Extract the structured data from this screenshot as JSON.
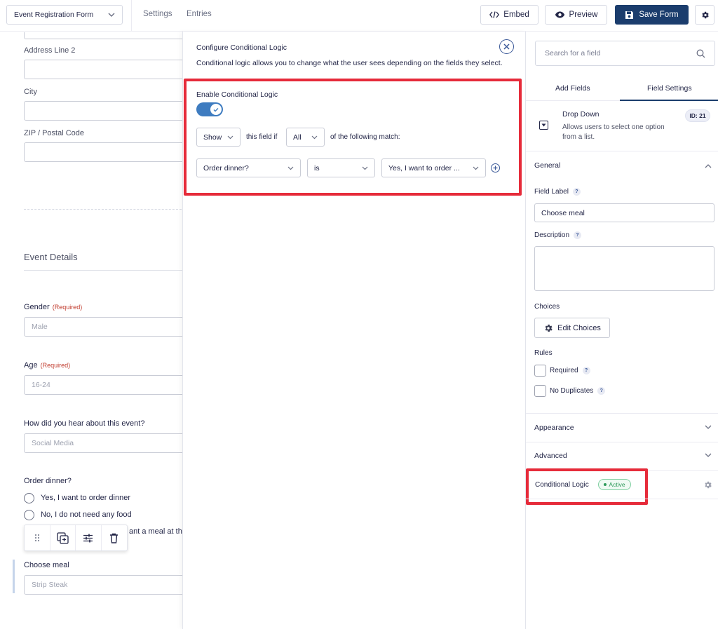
{
  "header": {
    "form_select": "Event Registration Form",
    "tabs": [
      "Settings",
      "Entries"
    ],
    "embed_label": "Embed",
    "preview_label": "Preview",
    "save_label": "Save Form"
  },
  "canvas": {
    "fields": [
      {
        "label": "Address Line 2"
      },
      {
        "label": "City"
      },
      {
        "label": "ZIP / Postal Code"
      }
    ],
    "section_title": "Event Details",
    "gender": {
      "label": "Gender",
      "required": "(Required)",
      "placeholder": "Male"
    },
    "age": {
      "label": "Age",
      "required": "(Required)",
      "placeholder": "16-24"
    },
    "hear": {
      "label": "How did you hear about this event?",
      "placeholder": "Social Media"
    },
    "dinner": {
      "label": "Order dinner?",
      "options": [
        "Yes, I want to order dinner",
        "No, I do not need any food"
      ],
      "partial_option": "ant a meal at th"
    },
    "choose_meal": {
      "label": "Choose meal",
      "placeholder": "Strip Steak"
    }
  },
  "modal": {
    "title": "Configure Conditional Logic",
    "description": "Conditional logic allows you to change what the user sees depending on the fields they select.",
    "enable_label": "Enable Conditional Logic",
    "toggle_on": true,
    "action": "Show",
    "this_field_if": "this field if",
    "match": "All",
    "following": "of the following match:",
    "rule": {
      "field": "Order dinner?",
      "operator": "is",
      "value": "Yes, I want to order ..."
    }
  },
  "sidebar": {
    "search_placeholder": "Search for a field",
    "tabs": [
      "Add Fields",
      "Field Settings"
    ],
    "active_tab": "Field Settings",
    "field_type": "Drop Down",
    "field_type_desc_1": "Allows users to select one option",
    "field_type_desc_2": "from a list.",
    "field_id": "ID: 21",
    "general": "General",
    "field_label_title": "Field Label",
    "field_label_value": "Choose meal",
    "description_title": "Description",
    "choices_title": "Choices",
    "edit_choices": "Edit Choices",
    "rules_title": "Rules",
    "rule_required": "Required",
    "rule_no_duplicates": "No Duplicates",
    "appearance": "Appearance",
    "advanced": "Advanced",
    "conditional_logic": "Conditional Logic",
    "active_badge": "Active"
  },
  "colors": {
    "primary": "#1b3d6d",
    "toggle": "#3e7cc0",
    "highlight": "#e62b3a",
    "active_badge": "#2e9a5a"
  }
}
